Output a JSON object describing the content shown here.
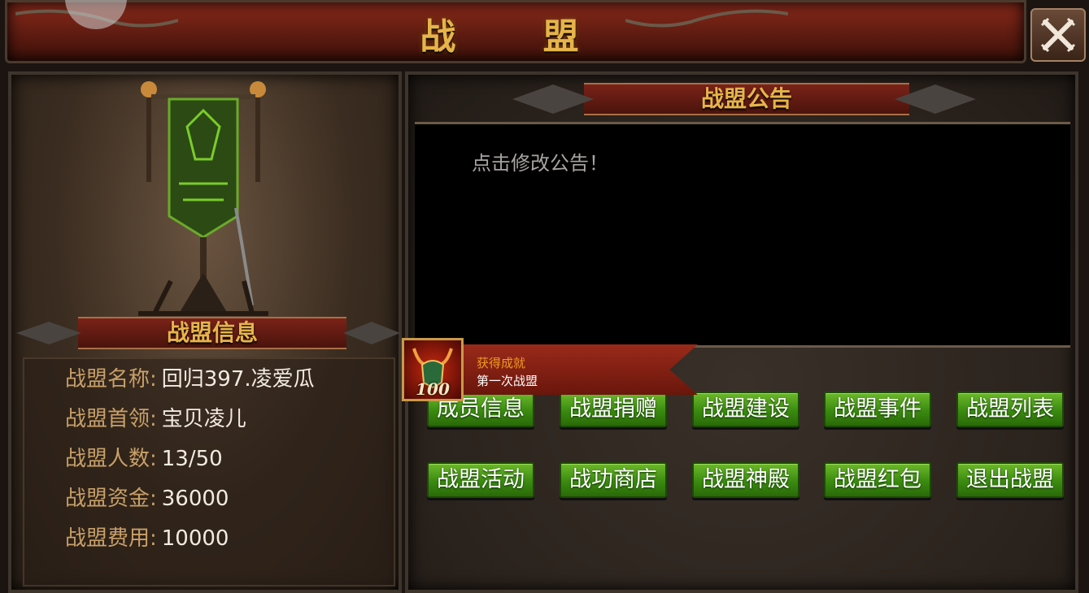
{
  "window": {
    "title": "战 盟"
  },
  "left": {
    "section_title": "战盟信息",
    "info": [
      {
        "label": "战盟名称:",
        "value": "回归397.凌爱瓜"
      },
      {
        "label": "战盟首领:",
        "value": "宝贝凌儿"
      },
      {
        "label": "战盟人数:",
        "value": "13/50"
      },
      {
        "label": "战盟资金:",
        "value": "36000"
      },
      {
        "label": "战盟费用:",
        "value": "10000"
      }
    ]
  },
  "notice": {
    "section_title": "战盟公告",
    "text": "点击修改公告！"
  },
  "buttons": [
    {
      "label": "成员信息"
    },
    {
      "label": "战盟捐赠"
    },
    {
      "label": "战盟建设"
    },
    {
      "label": "战盟事件"
    },
    {
      "label": "战盟列表"
    },
    {
      "label": "战盟活动"
    },
    {
      "label": "战功商店"
    },
    {
      "label": "战盟神殿"
    },
    {
      "label": "战盟红包"
    },
    {
      "label": "退出战盟"
    }
  ],
  "achievement": {
    "level": "100",
    "title": "获得成就",
    "name": "第一次战盟"
  },
  "icons": {
    "close": "close-x-icon",
    "banner": "guild-banner-emblem-icon",
    "achievement": "achievement-badge-icon"
  },
  "colors": {
    "title_gold": "#e6b44a",
    "button_green": "#4a9a18",
    "label_tan": "#c8a068",
    "achievement_orange": "#f09a20"
  }
}
